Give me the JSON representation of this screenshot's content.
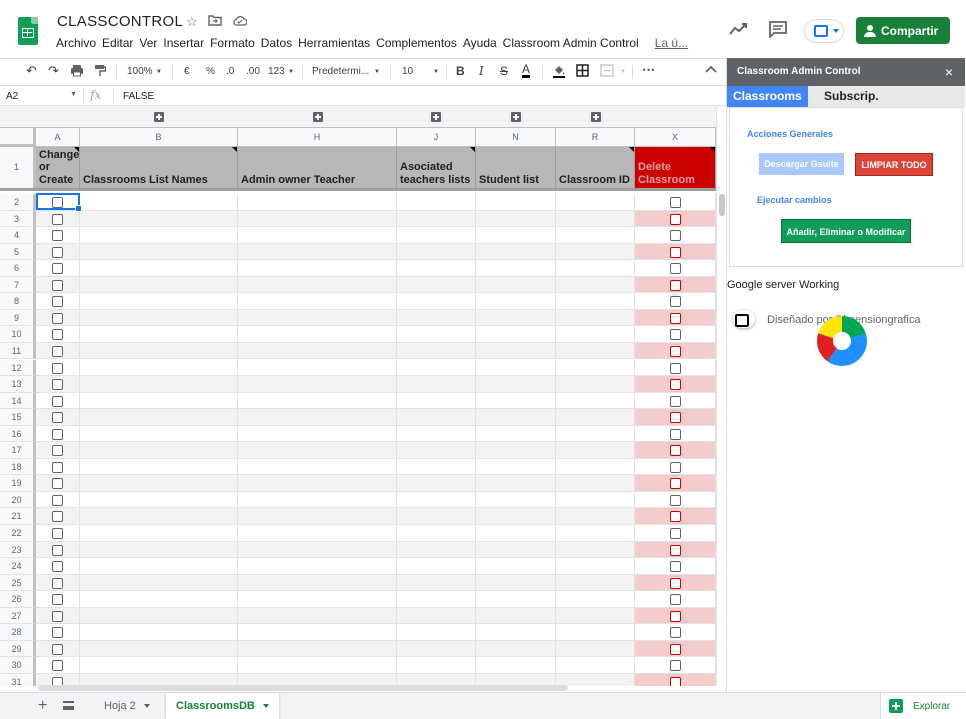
{
  "app": {
    "doc_title": "CLASSCONTROL",
    "title_icons": [
      "star-icon",
      "move-to-folder-icon",
      "cloud-status-icon"
    ],
    "menu": [
      "Archivo",
      "Editar",
      "Ver",
      "Insertar",
      "Formato",
      "Datos",
      "Herramientas",
      "Complementos",
      "Ayuda",
      "Classroom Admin Control"
    ],
    "last_edit": "La ú...",
    "share_label": "Compartir"
  },
  "toolbar": {
    "zoom": "100%",
    "currency": "€",
    "percent": "%",
    "dec_less": ".0",
    "dec_more": ".00",
    "more_formats": "123",
    "font": "Predetermi...",
    "font_size": "10",
    "bold": "B",
    "italic": "I",
    "strike": "S",
    "text_color": "A",
    "more": "⋯"
  },
  "formula_bar": {
    "cell_ref": "A2",
    "fx": "fx",
    "value": "FALSE"
  },
  "grid": {
    "columns": [
      {
        "letter": "A",
        "header": "Change or Create"
      },
      {
        "letter": "B",
        "header": "Classrooms List Names"
      },
      {
        "letter": "H",
        "header": "Admin owner Teacher"
      },
      {
        "letter": "J",
        "header": "Asociated teachers lists"
      },
      {
        "letter": "N",
        "header": "Student list"
      },
      {
        "letter": "R",
        "header": "Classroom ID"
      },
      {
        "letter": "X",
        "header": "Delete Classroom"
      }
    ],
    "header_row_number": "1",
    "data_rows": [
      "2",
      "3",
      "4",
      "5",
      "6",
      "7",
      "8",
      "9",
      "10",
      "11",
      "12",
      "13",
      "14",
      "15",
      "16",
      "17",
      "18",
      "19",
      "20",
      "21",
      "22",
      "23",
      "24",
      "25",
      "26",
      "27",
      "28",
      "29",
      "30",
      "31"
    ],
    "checkbox_values": "FALSE"
  },
  "sheets": {
    "tabs": [
      {
        "label": "Hoja 2",
        "active": false
      },
      {
        "label": "ClassroomsDB",
        "active": true
      }
    ],
    "explore_label": "Explorar"
  },
  "sidebar": {
    "title": "Classroom Admin Control",
    "close": "×",
    "tabs": [
      {
        "label": "Classrooms",
        "active": true
      },
      {
        "label": "Subscrip.",
        "active": false
      }
    ],
    "acciones_label": "Acciones Generales",
    "btn_descargar": "Descargar Gsuite",
    "btn_limpiar": "LIMPIAR TODO",
    "ejecutar_label": "Ejecutar cambios",
    "btn_anadir": "Añadir, Eliminar o Modificar",
    "server_status": "Google server Working",
    "designer_text": "Diseñado por Dimensiongrafica"
  },
  "colors": {
    "header_gray": "#b7b7b7",
    "delete_red": "#cc0000",
    "red_row_tint": "#f4cccc",
    "share_green": "#188038",
    "sidebar_blue": "#4285f4"
  }
}
